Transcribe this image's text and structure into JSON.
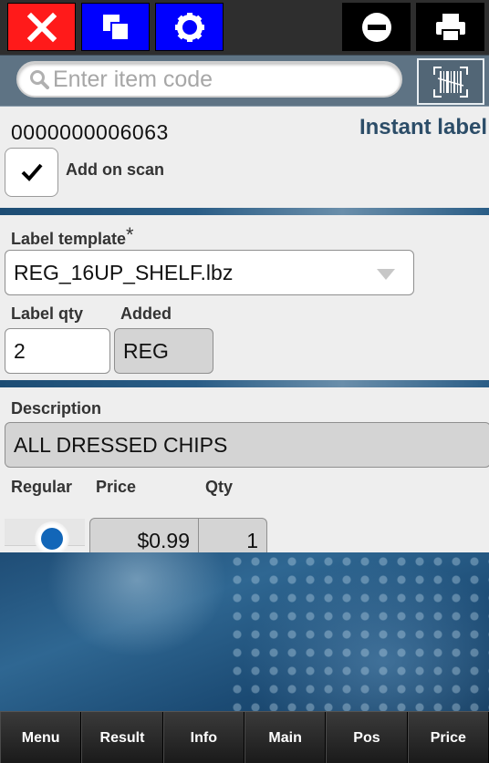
{
  "toolbar": {
    "close_icon": "close-icon",
    "windows_icon": "windows-icon",
    "settings_icon": "gear-icon",
    "minus_icon": "minus-circle-icon",
    "print_icon": "printer-icon",
    "colors": {
      "red": "#ff1a1a",
      "blue": "#0000ff",
      "black": "#000000"
    }
  },
  "search": {
    "placeholder": "Enter item code",
    "value": "",
    "scan_icon": "barcode-scan-icon"
  },
  "item": {
    "code": "0000000006063",
    "instant_label": "Instant label",
    "add_on_scan_label": "Add on scan",
    "add_on_scan_checked": true
  },
  "label": {
    "template_label": "Label template",
    "required_mark": "*",
    "template_value": "REG_16UP_SHELF.lbz",
    "qty_label": "Label qty",
    "qty_value": "2",
    "added_label": "Added",
    "added_value": "REG"
  },
  "details": {
    "description_label": "Description",
    "description_value": "ALL DRESSED CHIPS",
    "regular_label": "Regular",
    "regular_selected": true,
    "price_label": "Price",
    "price_value": "$0.99",
    "qty_label": "Qty",
    "qty_value": "1"
  },
  "bottom_nav": [
    "Menu",
    "Result",
    "Info",
    "Main",
    "Pos",
    "Price"
  ]
}
